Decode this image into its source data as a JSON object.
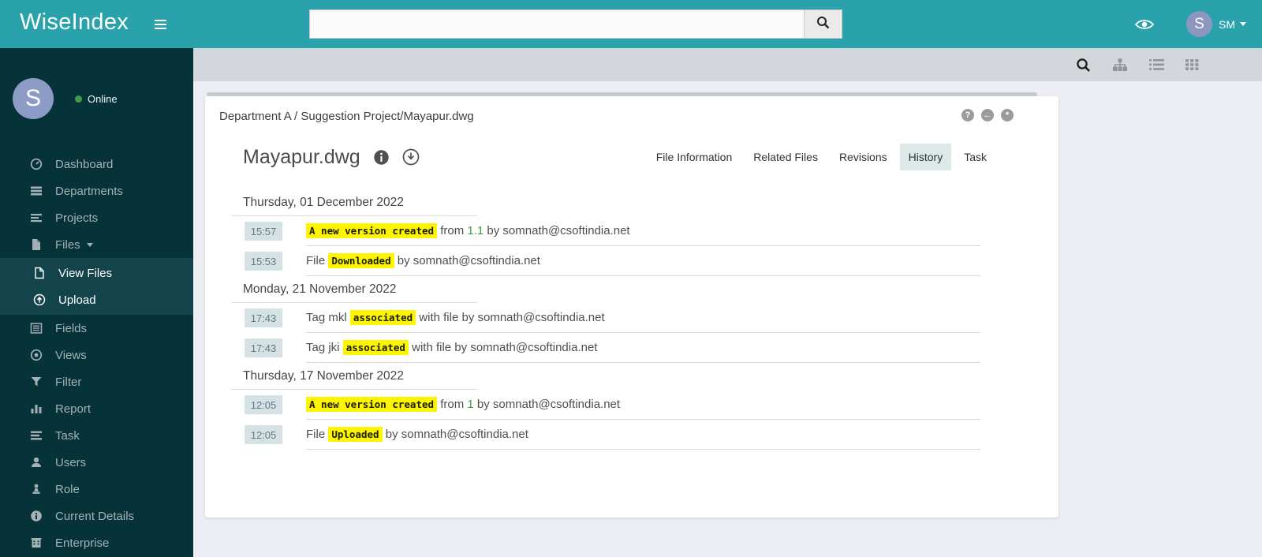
{
  "topbar": {
    "app_title": "WiseIndex",
    "search_placeholder": "",
    "user_avatar_letter": "S",
    "user_initials": "SM"
  },
  "sidebar": {
    "avatar_letter": "S",
    "status_label": "Online",
    "items": [
      {
        "label": "Dashboard",
        "icon": "dashboard-icon"
      },
      {
        "label": "Departments",
        "icon": "departments-icon"
      },
      {
        "label": "Projects",
        "icon": "projects-icon"
      },
      {
        "label": "Files",
        "icon": "files-icon"
      },
      {
        "label": "View Files",
        "icon": "view-files-icon"
      },
      {
        "label": "Upload",
        "icon": "upload-icon"
      },
      {
        "label": "Fields",
        "icon": "fields-icon"
      },
      {
        "label": "Views",
        "icon": "views-icon"
      },
      {
        "label": "Filter",
        "icon": "filter-icon"
      },
      {
        "label": "Report",
        "icon": "report-icon"
      },
      {
        "label": "Task",
        "icon": "task-icon"
      },
      {
        "label": "Users",
        "icon": "users-icon"
      },
      {
        "label": "Role",
        "icon": "role-icon"
      },
      {
        "label": "Current Details",
        "icon": "current-details-icon"
      },
      {
        "label": "Enterprise",
        "icon": "enterprise-icon"
      }
    ]
  },
  "toolbar": {
    "icons": [
      "search-icon",
      "sitemap-icon",
      "list-view-icon",
      "grid-view-icon"
    ]
  },
  "card": {
    "breadcrumb": "Department A / Suggestion Project/Mayapur.dwg",
    "title": "Mayapur.dwg",
    "header_icons": {
      "help": "?",
      "collapse": "←",
      "toggle": "*"
    },
    "tabs": [
      {
        "label": "File Information"
      },
      {
        "label": "Related Files"
      },
      {
        "label": "Revisions"
      },
      {
        "label": "History",
        "active": true
      },
      {
        "label": "Task"
      }
    ]
  },
  "history": {
    "groups": [
      {
        "date": "Thursday, 01 December 2022",
        "rows": [
          {
            "time": "15:57",
            "pre": "",
            "tag": "A new version created",
            "mid": " from ",
            "version": "1.1",
            "post": " by somnath@csoftindia.net"
          },
          {
            "time": "15:53",
            "pre": "File ",
            "tag": "Downloaded",
            "mid": "",
            "version": "",
            "post": " by somnath@csoftindia.net"
          }
        ]
      },
      {
        "date": "Monday, 21 November 2022",
        "rows": [
          {
            "time": "17:43",
            "pre": "Tag mkl ",
            "tag": "associated",
            "mid": "",
            "version": "",
            "post": " with file by somnath@csoftindia.net"
          },
          {
            "time": "17:43",
            "pre": "Tag jki ",
            "tag": "associated",
            "mid": "",
            "version": "",
            "post": " with file by somnath@csoftindia.net"
          }
        ]
      },
      {
        "date": "Thursday, 17 November 2022",
        "rows": [
          {
            "time": "12:05",
            "pre": "",
            "tag": "A new version created",
            "mid": " from ",
            "version": "1",
            "post": " by somnath@csoftindia.net"
          },
          {
            "time": "12:05",
            "pre": "File ",
            "tag": "Uploaded",
            "mid": "",
            "version": "",
            "post": " by somnath@csoftindia.net"
          }
        ]
      }
    ]
  },
  "colors": {
    "accent": "#2aa2ac",
    "sidebar_bg": "#06333a",
    "submenu_bg": "#14444b",
    "highlight_bg": "#fdf400",
    "version_green": "#3f9b45",
    "time_badge_bg": "#d4e2e5",
    "toolbar_bg": "#d3d6db"
  }
}
